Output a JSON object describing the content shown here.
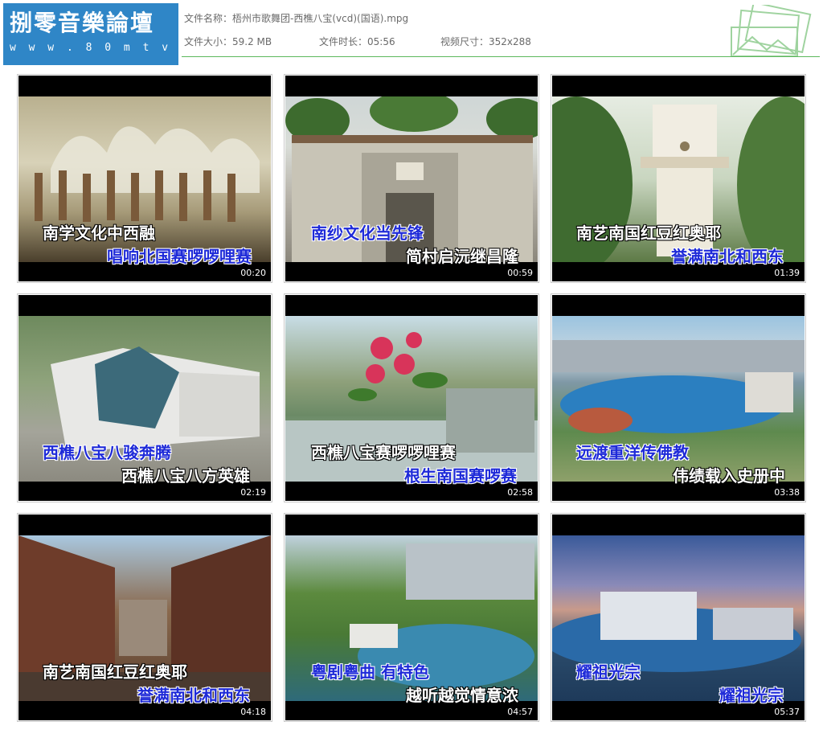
{
  "logo": {
    "title": "捌零音樂論壇",
    "url": "w w w . 8 0 m t v . c o m"
  },
  "file": {
    "name": "文件名称：梧州市歌舞团-西樵八宝(vcd)(国语).mpg",
    "size": "文件大小：59.2 MB",
    "duration": "文件时长：05:56",
    "dimensions": "视频尺寸：352x288"
  },
  "colors": {
    "accent_line": "#5cb85c",
    "logo_bg": "#2f86c7",
    "lyric_highlight": "#1e2ad8"
  },
  "thumbnails": [
    {
      "line1": "南学文化中西融",
      "line2": "唱响北国赛啰啰哩赛",
      "time": "00:20"
    },
    {
      "line1": "南纱文化当先锋",
      "line2": "简村启沅继昌隆",
      "time": "00:59"
    },
    {
      "line1": "南艺南国红豆红奥耶",
      "line2": "誉满南北和西东",
      "time": "01:39"
    },
    {
      "line1": "西樵八宝八骏奔腾",
      "line2": "西樵八宝八方英雄",
      "time": "02:19"
    },
    {
      "line1": "西樵八宝赛啰啰哩赛",
      "line2": "根生南国赛啰赛",
      "time": "02:58"
    },
    {
      "line1": "远渡重洋传佛教",
      "line2": "伟绩载入史册中",
      "time": "03:38"
    },
    {
      "line1": "南艺南国红豆红奥耶",
      "line2": "誉满南北和西东",
      "time": "04:18"
    },
    {
      "line1": "粤剧粤曲 有特色",
      "line2": "越听越觉情意浓",
      "time": "04:57"
    },
    {
      "line1": "耀祖光宗",
      "line2": "耀祖光宗",
      "time": "05:37"
    }
  ]
}
